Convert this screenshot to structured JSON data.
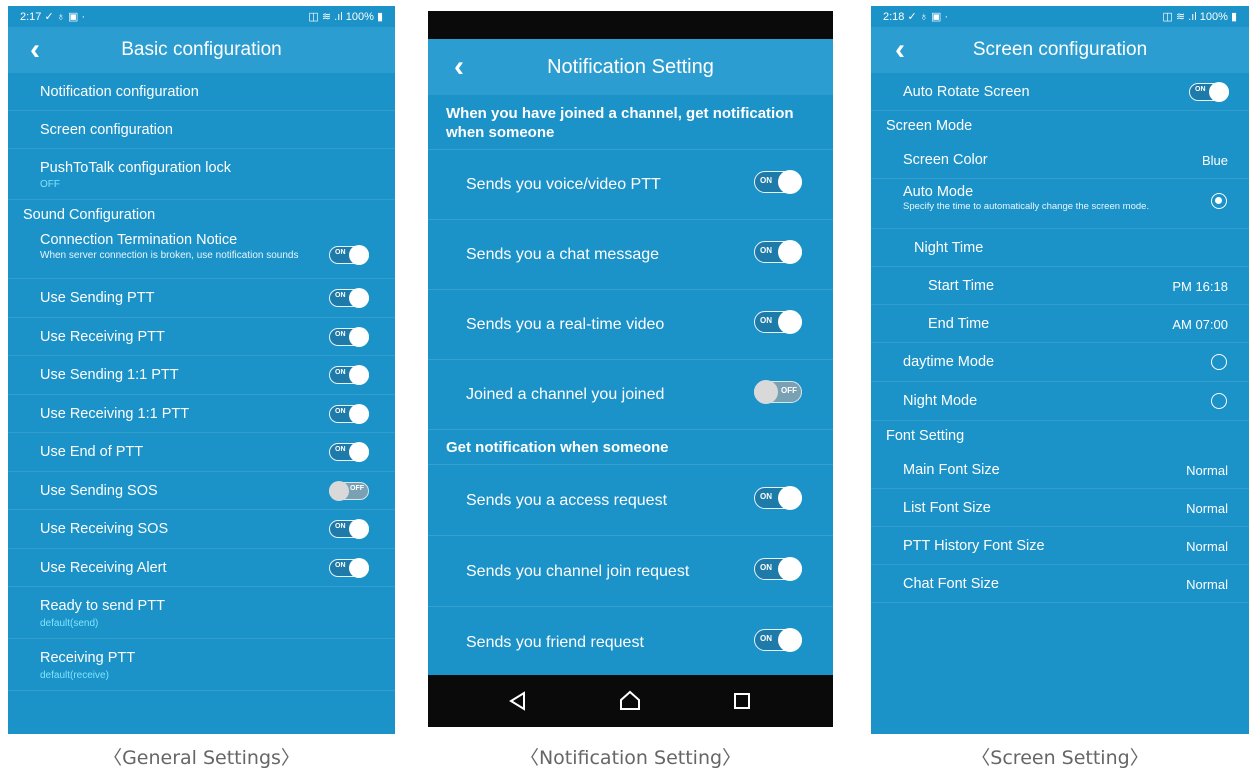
{
  "general": {
    "status_time": "2:17 ✓ ♁ ▣ ·",
    "status_right": "◫ ≋ .ıl 100% ▮",
    "title": "Basic configuration",
    "links": [
      {
        "label": "Notification configuration"
      },
      {
        "label": "Screen configuration"
      },
      {
        "label": "PushToTalk configuration lock",
        "sub": "OFF"
      }
    ],
    "sound_section": "Sound Configuration",
    "connection": {
      "label": "Connection Termination Notice",
      "sub": "When server connection is broken, use notification sounds",
      "state": "ON"
    },
    "toggles": [
      {
        "label": "Use Sending PTT",
        "state": "ON"
      },
      {
        "label": "Use Receiving PTT",
        "state": "ON"
      },
      {
        "label": "Use Sending 1:1 PTT",
        "state": "ON"
      },
      {
        "label": "Use Receiving 1:1 PTT",
        "state": "ON"
      },
      {
        "label": "Use End of PTT",
        "state": "ON"
      },
      {
        "label": "Use Sending SOS",
        "state": "OFF"
      },
      {
        "label": "Use Receiving SOS",
        "state": "ON"
      },
      {
        "label": "Use Receiving Alert",
        "state": "ON"
      }
    ],
    "ready": {
      "label": "Ready to send PTT",
      "sub": "default(send)"
    },
    "receiving": {
      "label": "Receiving PTT",
      "sub": "default(receive)"
    },
    "caption": "〈General Settings〉"
  },
  "notification": {
    "title": "Notification Setting",
    "section1": "When you have joined a channel, get notification when someone",
    "items1": [
      {
        "label": "Sends you voice/video PTT",
        "state": "ON"
      },
      {
        "label": "Sends you a chat message",
        "state": "ON"
      },
      {
        "label": "Sends you a real-time video",
        "state": "ON"
      },
      {
        "label": "Joined a channel you joined",
        "state": "OFF"
      }
    ],
    "section2": "Get notification when someone",
    "items2": [
      {
        "label": "Sends you a access request",
        "state": "ON"
      },
      {
        "label": "Sends you channel join request",
        "state": "ON"
      },
      {
        "label": "Sends you friend request",
        "state": "ON"
      }
    ],
    "caption": "〈Notification Setting〉"
  },
  "screen": {
    "status_time": "2:18 ✓ ♁ ▣ ·",
    "status_right": "◫ ≋ .ıl 100% ▮",
    "title": "Screen configuration",
    "auto_rotate": {
      "label": "Auto Rotate Screen",
      "state": "ON"
    },
    "screen_mode_section": "Screen Mode",
    "screen_color": {
      "label": "Screen Color",
      "value": "Blue"
    },
    "auto_mode": {
      "label": "Auto Mode",
      "sub": "Specify the time to automatically change the screen mode.",
      "checked": true
    },
    "night_time": "Night Time",
    "start_time": {
      "label": "Start Time",
      "value": "PM 16:18"
    },
    "end_time": {
      "label": "End Time",
      "value": "AM 07:00"
    },
    "daytime_mode": {
      "label": "daytime Mode",
      "checked": false
    },
    "night_mode": {
      "label": "Night Mode",
      "checked": false
    },
    "font_section": "Font Setting",
    "fonts": [
      {
        "label": "Main Font Size",
        "value": "Normal"
      },
      {
        "label": "List Font Size",
        "value": "Normal"
      },
      {
        "label": "PTT History Font Size",
        "value": "Normal"
      },
      {
        "label": "Chat Font Size",
        "value": "Normal"
      }
    ],
    "caption": "〈Screen Setting〉"
  }
}
